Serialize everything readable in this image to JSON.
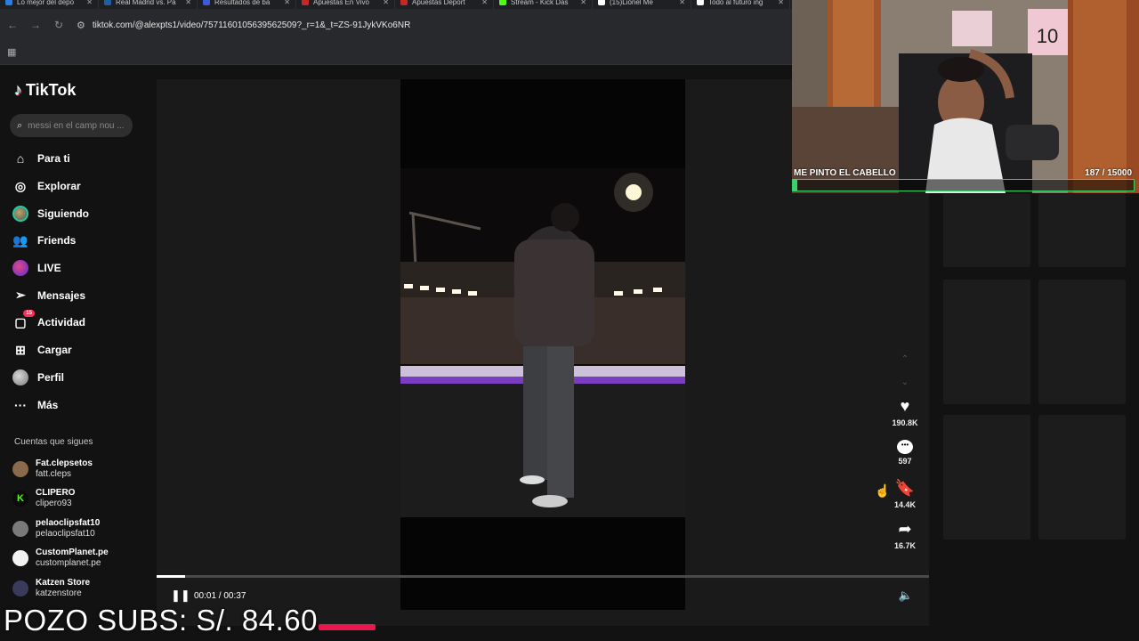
{
  "browser": {
    "tabs": [
      {
        "title": "Lo mejor del depo",
        "color": "#2a7de1"
      },
      {
        "title": "Real Madrid vs. Pa",
        "color": "#1f5fa8"
      },
      {
        "title": "Resultados de ba",
        "color": "#3b5bdb"
      },
      {
        "title": "Apuestas En Vivo",
        "color": "#c62828"
      },
      {
        "title": "Apuestas Deport",
        "color": "#c62828"
      },
      {
        "title": "Stream - Kick Das",
        "color": "#53fc18"
      },
      {
        "title": "(15)Lionel Me",
        "color": "#ffffff"
      },
      {
        "title": "Todo al futuro ing",
        "color": "#ffffff"
      }
    ],
    "url": "tiktok.com/@alexpts1/video/7571160105639562509?_r=1&_t=ZS-91JykVKo6NR"
  },
  "sidebar": {
    "logo": "TikTok",
    "search_placeholder": "messi en el camp nou ...",
    "nav": [
      {
        "label": "Para ti",
        "icon": "home-icon"
      },
      {
        "label": "Explorar",
        "icon": "compass-icon"
      },
      {
        "label": "Siguiendo",
        "icon": "following-avatar-icon"
      },
      {
        "label": "Friends",
        "icon": "friends-icon"
      },
      {
        "label": "LIVE",
        "icon": "live-icon"
      },
      {
        "label": "Mensajes",
        "icon": "send-icon"
      },
      {
        "label": "Actividad",
        "icon": "activity-icon",
        "badge": "15"
      },
      {
        "label": "Cargar",
        "icon": "upload-icon"
      },
      {
        "label": "Perfil",
        "icon": "profile-icon"
      },
      {
        "label": "Más",
        "icon": "more-icon"
      }
    ],
    "following_header": "Cuentas que sigues",
    "following": [
      {
        "name": "Fat.clepsetos",
        "user": "fatt.cleps"
      },
      {
        "name": "CLIPERO",
        "user": "clipero93"
      },
      {
        "name": "pelaoclipsfat10",
        "user": "pelaoclipsfat10"
      },
      {
        "name": "CustomPlanet.pe",
        "user": "customplanet.pe"
      },
      {
        "name": "Katzen Store",
        "user": "katzenstore"
      }
    ]
  },
  "video": {
    "time": "00:01 / 00:37",
    "progress": 0.037
  },
  "actions": {
    "likes": "190.8K",
    "comments": "597",
    "saves": "14.4K",
    "shares": "16.7K"
  },
  "overlay": {
    "cam_title": "ME PINTO EL CABELLO",
    "cam_count": "187 / 15000",
    "cam_progress": 0.0125,
    "pozo_text": "POZO SUBS: S/. 84.60",
    "accent": "#e8184f"
  }
}
